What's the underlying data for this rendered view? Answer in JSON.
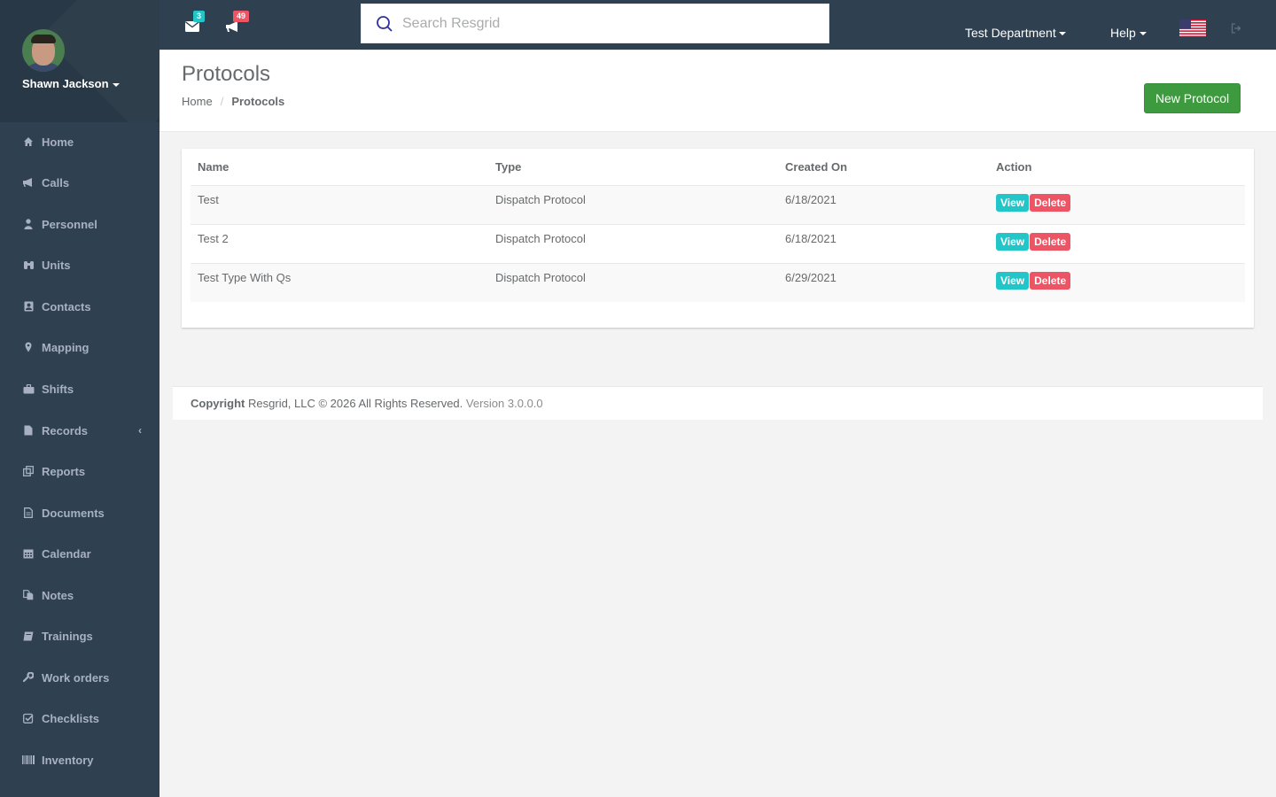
{
  "user": {
    "name": "Shawn Jackson"
  },
  "sidebar": {
    "items": [
      {
        "label": "Home",
        "icon": "home-icon"
      },
      {
        "label": "Calls",
        "icon": "bullhorn-icon"
      },
      {
        "label": "Personnel",
        "icon": "user-icon"
      },
      {
        "label": "Units",
        "icon": "binoculars-icon"
      },
      {
        "label": "Contacts",
        "icon": "address-book-icon"
      },
      {
        "label": "Mapping",
        "icon": "map-marker-icon"
      },
      {
        "label": "Shifts",
        "icon": "briefcase-icon"
      },
      {
        "label": "Records",
        "icon": "file-icon"
      },
      {
        "label": "Reports",
        "icon": "clone-icon"
      },
      {
        "label": "Documents",
        "icon": "file-text-icon"
      },
      {
        "label": "Calendar",
        "icon": "calendar-icon"
      },
      {
        "label": "Notes",
        "icon": "files-icon"
      },
      {
        "label": "Trainings",
        "icon": "book-icon"
      },
      {
        "label": "Work orders",
        "icon": "wrench-icon"
      },
      {
        "label": "Checklists",
        "icon": "check-square-icon"
      },
      {
        "label": "Inventory",
        "icon": "barcode-icon"
      }
    ]
  },
  "topbar": {
    "messages_count": "3",
    "alerts_count": "49",
    "search_placeholder": "Search Resgrid",
    "department": "Test Department",
    "help": "Help"
  },
  "colors": {
    "sidebar_bg": "#2f4050",
    "primary_green": "#3e9a3e",
    "info": "#23c6c8",
    "danger": "#ed5565"
  },
  "page": {
    "title": "Protocols",
    "breadcrumb": [
      "Home",
      "Protocols"
    ],
    "new_button": "New Protocol"
  },
  "table": {
    "headers": [
      "Name",
      "Type",
      "Created On",
      "Action"
    ],
    "rows": [
      {
        "name": "Test",
        "type": "Dispatch Protocol",
        "created": "6/18/2021"
      },
      {
        "name": "Test 2",
        "type": "Dispatch Protocol",
        "created": "6/18/2021"
      },
      {
        "name": "Test Type With Qs",
        "type": "Dispatch Protocol",
        "created": "6/29/2021"
      }
    ],
    "view_label": "View",
    "delete_label": "Delete"
  },
  "footer": {
    "copyright_label": "Copyright",
    "copyright_text": "Resgrid, LLC © 2026 All Rights Reserved.",
    "version": "Version 3.0.0.0"
  }
}
